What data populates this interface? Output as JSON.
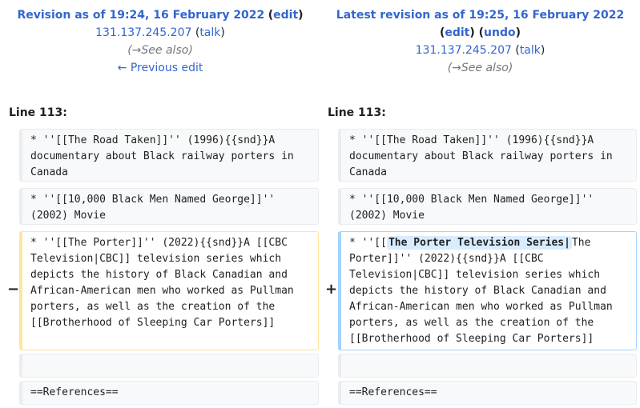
{
  "old_revision": {
    "title": "Revision as of 19:24, 16 February 2022",
    "edit_label": "edit",
    "user_ip": "131.137.245.207",
    "talk_label": "talk",
    "summary_arrow": "→",
    "summary_text": "See also",
    "previous_edit_label": "← Previous edit"
  },
  "new_revision": {
    "title": "Latest revision as of 19:25, 16 February 2022",
    "edit_label": "edit",
    "undo_label": "undo",
    "user_ip": "131.137.245.207",
    "talk_label": "talk",
    "summary_arrow": "→",
    "summary_text": "See also"
  },
  "diff": {
    "left_line_label": "Line 113:",
    "right_line_label": "Line 113:",
    "context_rows": [
      "* ''[[The Road Taken]]'' (1996){{snd}}A documentary about Black railway porters in Canada",
      "* ''[[10,000 Black Men Named George]]'' (2002) Movie"
    ],
    "deleted_line": "* ''[[The Porter]]'' (2022){{snd}}A [[CBC Television|CBC]] television series which depicts the history of Black Canadian and African-American men who worked as Pullman porters, as well as the creation of the [[Brotherhood of Sleeping Car Porters]]",
    "added_prefix": "* ''[[",
    "added_highlight": "The Porter Television Series|",
    "added_suffix": "The Porter]]'' (2022){{snd}}A [[CBC Television|CBC]] television series which depicts the history of Black Canadian and African-American men who worked as Pullman porters, as well as the creation of the [[Brotherhood of Sleeping Car Porters]]",
    "empty_context": "",
    "references_line": "==References==",
    "minus_marker": "−",
    "plus_marker": "+"
  },
  "colors": {
    "link": "#3366cc",
    "deleted_border": "#ffe49c",
    "added_border": "#a3d3ff",
    "added_highlight": "#d8ecff",
    "context_bg": "#f8f9fa"
  }
}
